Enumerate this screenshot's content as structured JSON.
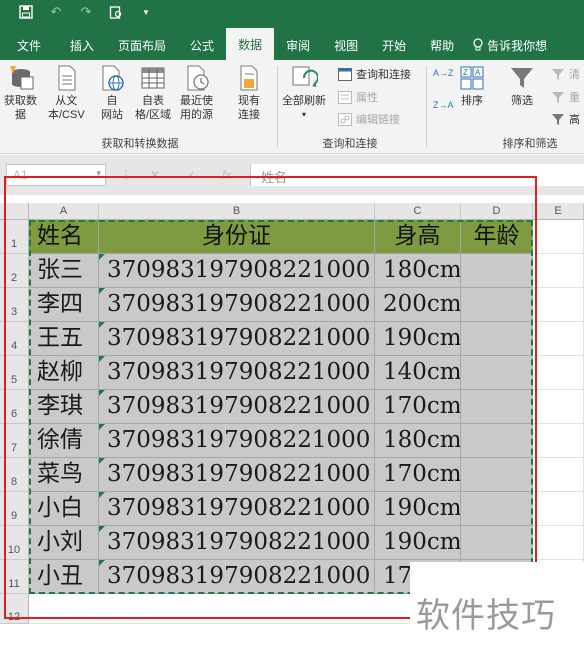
{
  "quick_access": {
    "save_icon": "save-icon",
    "undo_icon": "undo-icon",
    "redo_icon": "redo-icon",
    "preview_icon": "print-preview-icon",
    "customize_icon": "customize-qat-icon"
  },
  "tabs": [
    "文件",
    "插入",
    "页面布局",
    "公式",
    "数据",
    "审阅",
    "视图",
    "开始",
    "帮助"
  ],
  "active_tab": "数据",
  "tell_me": "告诉我你想",
  "ribbon": {
    "get_data": [
      "获取数",
      "据"
    ],
    "from_csv": [
      "从文",
      "本/CSV"
    ],
    "from_web": [
      "自",
      "网站"
    ],
    "from_table": [
      "自表",
      "格/区域"
    ],
    "recent_sources": [
      "最近使",
      "用的源"
    ],
    "existing_connections": [
      "现有",
      "连接"
    ],
    "group_get_transform": "获取和转换数据",
    "refresh_all": [
      "全部刷新"
    ],
    "queries_connections": "查询和连接",
    "properties": "属性",
    "edit_links": "编辑链接",
    "group_queries": "查询和连接",
    "sort_asc": "A→Z",
    "sort_desc": "Z→A",
    "sort": "排序",
    "filter": "筛选",
    "clear": "清",
    "reapply": "重",
    "advanced": "高",
    "group_sort_filter": "排序和筛选"
  },
  "formula_bar": {
    "name_box": "A1",
    "fx": "fx",
    "content": "姓名"
  },
  "columns": [
    "A",
    "B",
    "C",
    "D",
    "E"
  ],
  "rows": [
    "1",
    "2",
    "3",
    "4",
    "5",
    "6",
    "7",
    "8",
    "9",
    "10",
    "11",
    "12"
  ],
  "sheet": {
    "header": [
      "姓名",
      "身份证",
      "身高",
      "年龄"
    ],
    "data": [
      [
        "张三",
        "370983197908221000",
        "180cm",
        ""
      ],
      [
        "李四",
        "370983197908221000",
        "200cm",
        ""
      ],
      [
        "王五",
        "370983197908221000",
        "190cm",
        ""
      ],
      [
        "赵柳",
        "370983197908221000",
        "140cm",
        ""
      ],
      [
        "李琪",
        "370983197908221000",
        "170cm",
        ""
      ],
      [
        "徐倩",
        "370983197908221000",
        "180cm",
        ""
      ],
      [
        "菜鸟",
        "370983197908221000",
        "170cm",
        ""
      ],
      [
        "小白",
        "370983197908221000",
        "190cm",
        ""
      ],
      [
        "小刘",
        "370983197908221000",
        "190cm",
        ""
      ],
      [
        "小丑",
        "370983197908221000",
        "170cm",
        ""
      ]
    ]
  },
  "watermark": "软件技巧",
  "colors": {
    "excel_green": "#217346",
    "header_fill": "#7f9b42",
    "data_fill": "#c9c9c9",
    "annotation_red": "#e02020"
  }
}
